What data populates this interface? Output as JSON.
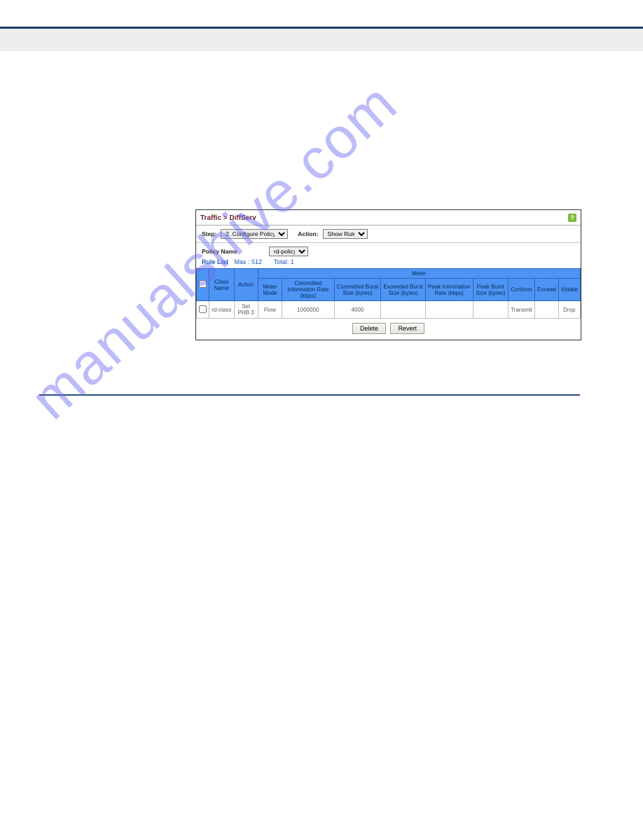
{
  "breadcrumb": "Traffic > DiffServ",
  "controls": {
    "step_label": "Step:",
    "step_value": "2. Configure Policy",
    "action_label": "Action:",
    "action_value": "Show Rule",
    "policy_name_label": "Policy Name",
    "policy_name_value": "rd-policy"
  },
  "rulelist": {
    "label": "Rule List",
    "max": "Max : 512",
    "total": "Total: 1"
  },
  "headers": {
    "class_name": "Class Name",
    "action": "Action",
    "meter": "Meter",
    "meter_mode": "Meter Mode",
    "cir": "Committed Information Rate (kbps)",
    "cbs": "Committed Burst Size (bytes)",
    "ebs": "Exceeded Burst Size (bytes)",
    "pir": "Peak Information Rate (kbps)",
    "pbs": "Peak Burst Size (bytes)",
    "conform": "Conform",
    "exceed": "Exceed",
    "violate": "Violate"
  },
  "row": {
    "class_name": "rd-class",
    "action": "Set PHB 3",
    "meter_mode": "Flow",
    "cir": "1000000",
    "cbs": "4000",
    "ebs": "",
    "pir": "",
    "pbs": "",
    "conform": "Transmit",
    "exceed": "",
    "violate": "Drop"
  },
  "buttons": {
    "delete": "Delete",
    "revert": "Revert"
  },
  "watermark": "manualshive.com"
}
